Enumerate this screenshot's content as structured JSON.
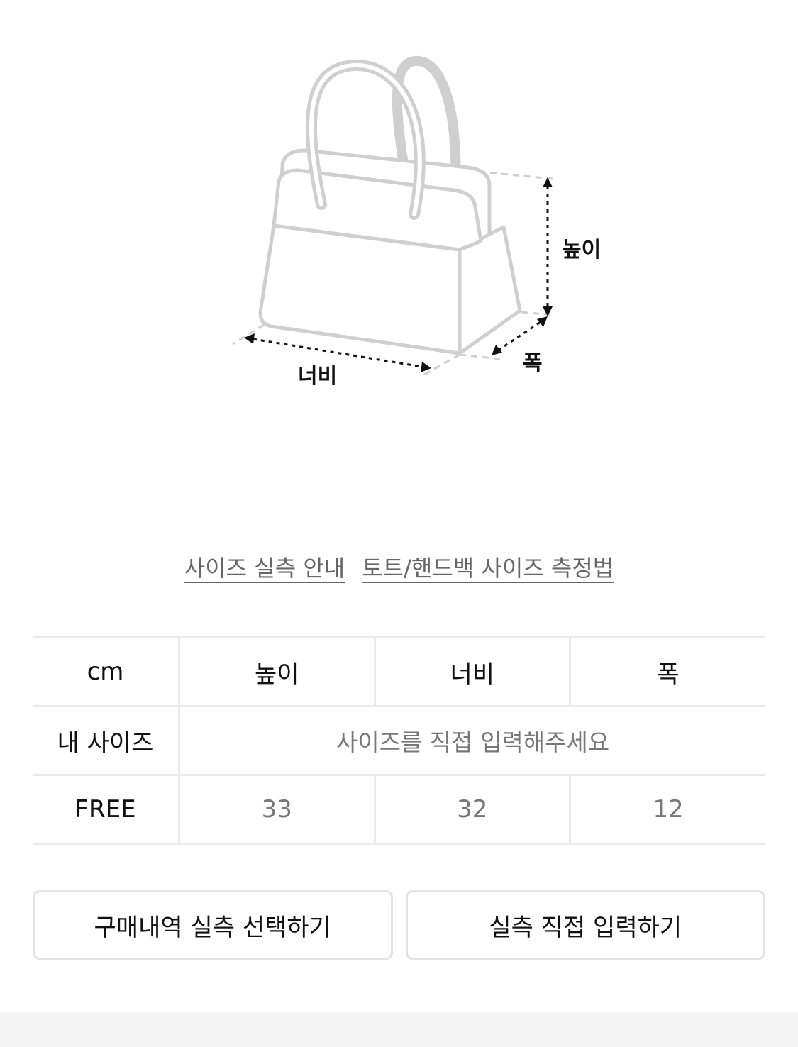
{
  "diagram": {
    "height_label": "높이",
    "width_label": "너비",
    "depth_label": "폭"
  },
  "guide_links": {
    "size_guide": "사이즈 실측 안내",
    "measure_method": "토트/핸드백 사이즈 측정법"
  },
  "size_table": {
    "header": [
      "cm",
      "높이",
      "너비",
      "폭"
    ],
    "my_size": {
      "label": "내 사이즈",
      "placeholder": "사이즈를 직접 입력해주세요"
    },
    "rows": [
      {
        "size": "FREE",
        "values": [
          "33",
          "32",
          "12"
        ]
      }
    ]
  },
  "buttons": {
    "select_history": "구매내역 실측 선택하기",
    "direct_input": "실측 직접 입력하기"
  },
  "colors": {
    "outline": "#cfcfcf",
    "arrow": "#111111",
    "table_border": "#ebebeb",
    "muted_text": "#777777"
  }
}
